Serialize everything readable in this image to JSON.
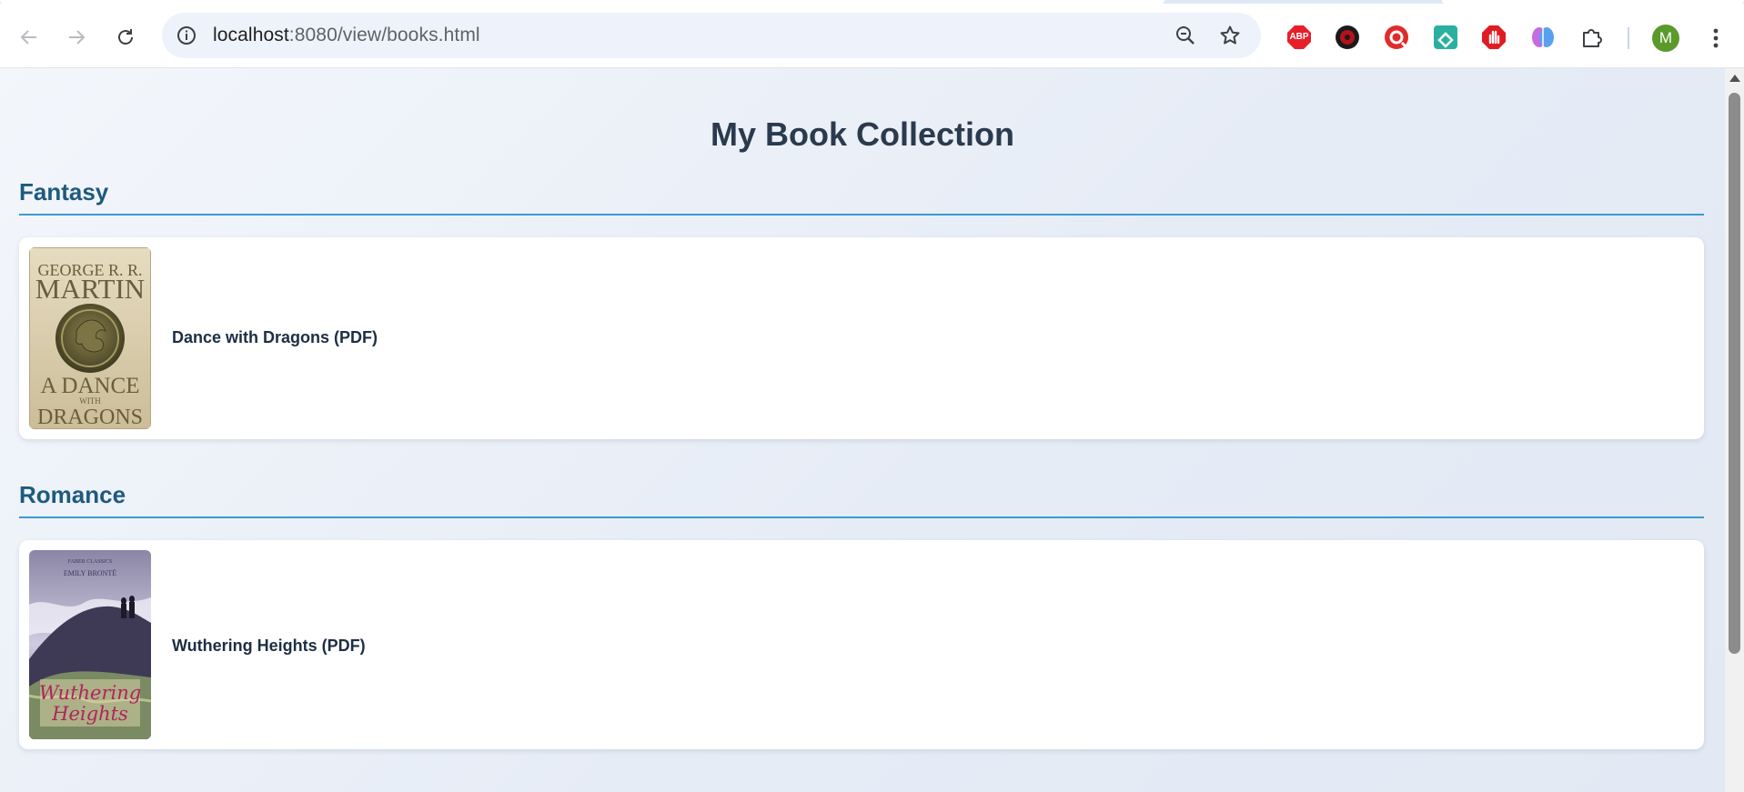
{
  "browser": {
    "url_host": "localhost",
    "url_path": ":8080/view/books.html",
    "extensions": [
      "abp-icon",
      "ublock-icon",
      "record-icon",
      "feedly-icon",
      "stop-hand-icon",
      "brain-icon",
      "puzzle-extensions-icon"
    ],
    "abp_label": "ABP",
    "profile_initial": "M",
    "colors": {
      "avatar": "#5a9a2a",
      "omnibox": "#eef2fa"
    }
  },
  "page": {
    "title": "My Book Collection",
    "sections": [
      {
        "name": "Fantasy",
        "books": [
          {
            "title": "Dance with Dragons (PDF)",
            "cover": {
              "author_line1": "GEORGE R. R.",
              "author_line2": "MARTIN",
              "title_line1": "A DANCE",
              "title_line2": "WITH",
              "title_line3": "DRAGONS"
            }
          }
        ]
      },
      {
        "name": "Romance",
        "books": [
          {
            "title": "Wuthering Heights (PDF)",
            "cover": {
              "series": "FABER CLASSICS",
              "author": "EMILY BRONTË",
              "title_line1": "Wuthering",
              "title_line2": "Heights"
            }
          }
        ]
      }
    ],
    "colors": {
      "heading": "#2b3a4d",
      "section": "#1d5a7e",
      "rule": "#3b9ad0"
    }
  }
}
